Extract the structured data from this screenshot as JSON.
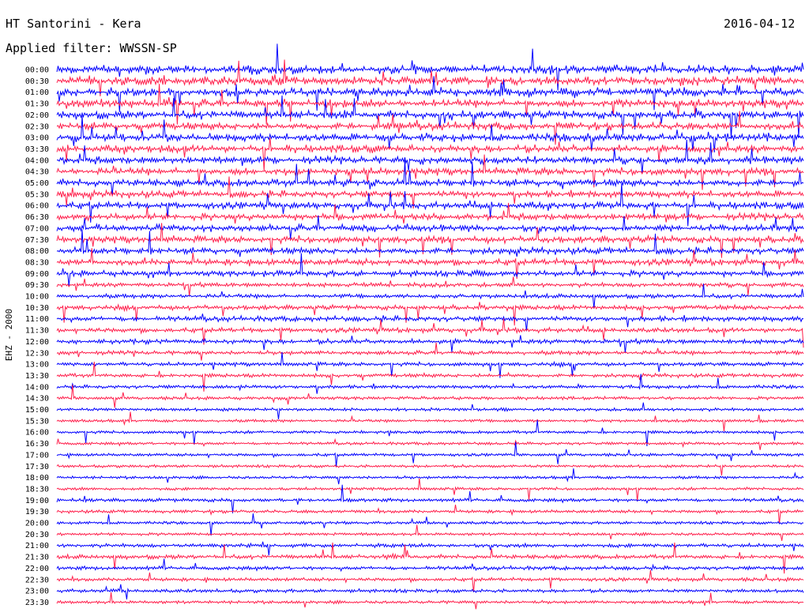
{
  "header": {
    "station": "HT Santorini - Kera",
    "date": "2016-04-12",
    "filter": "Applied filter: WWSSN-SP"
  },
  "channel_label": "EHZ - 2000",
  "chart_data": {
    "type": "line",
    "title": "HT Santorini - Kera",
    "subtitle": "Applied filter: WWSSN-SP",
    "date": "2016-04-12",
    "ylabel": "EHZ - 2000",
    "row_interval_minutes": 30,
    "trace_colors": [
      "#0000ff",
      "#ff1e4b"
    ],
    "row_labels": [
      "00:00",
      "00:30",
      "01:00",
      "01:30",
      "02:00",
      "02:30",
      "03:00",
      "03:30",
      "04:00",
      "04:30",
      "05:00",
      "05:30",
      "06:00",
      "06:30",
      "07:00",
      "07:30",
      "08:00",
      "08:30",
      "09:00",
      "09:30",
      "10:00",
      "10:30",
      "11:00",
      "11:30",
      "12:00",
      "12:30",
      "13:00",
      "13:30",
      "14:00",
      "14:30",
      "15:00",
      "15:30",
      "16:00",
      "16:30",
      "17:00",
      "17:30",
      "18:00",
      "18:30",
      "19:00",
      "19:30",
      "20:00",
      "20:30",
      "21:00",
      "21:30",
      "22:00",
      "22:30",
      "23:00",
      "23:30"
    ],
    "row_activity": [
      1.0,
      1.0,
      0.95,
      0.9,
      0.9,
      0.85,
      0.9,
      0.85,
      0.85,
      0.8,
      0.8,
      0.75,
      0.75,
      0.75,
      0.75,
      0.75,
      0.7,
      0.7,
      0.6,
      0.4,
      0.35,
      0.45,
      0.5,
      0.45,
      0.45,
      0.35,
      0.3,
      0.3,
      0.25,
      0.2,
      0.2,
      0.15,
      0.15,
      0.15,
      0.15,
      0.15,
      0.15,
      0.15,
      0.25,
      0.2,
      0.15,
      0.15,
      0.3,
      0.35,
      0.3,
      0.25,
      0.25,
      0.2
    ]
  }
}
